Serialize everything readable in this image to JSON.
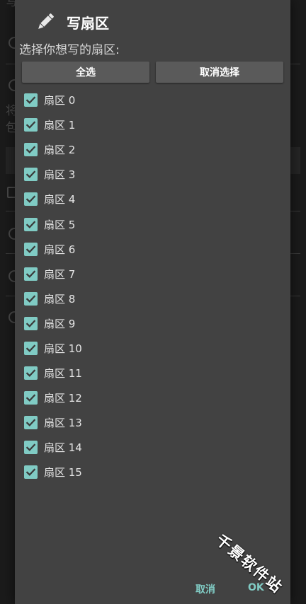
{
  "dialog": {
    "title": "写扇区",
    "icon": "pencil-icon",
    "subtitle": "选择你想写的扇区:",
    "select_all_label": "全选",
    "deselect_label": "取消选择",
    "sectors": [
      {
        "label": "扇区 0",
        "checked": true
      },
      {
        "label": "扇区 1",
        "checked": true
      },
      {
        "label": "扇区 2",
        "checked": true
      },
      {
        "label": "扇区 3",
        "checked": true
      },
      {
        "label": "扇区 4",
        "checked": true
      },
      {
        "label": "扇区 5",
        "checked": true
      },
      {
        "label": "扇区 6",
        "checked": true
      },
      {
        "label": "扇区 7",
        "checked": true
      },
      {
        "label": "扇区 8",
        "checked": true
      },
      {
        "label": "扇区 9",
        "checked": true
      },
      {
        "label": "扇区 10",
        "checked": true
      },
      {
        "label": "扇区 11",
        "checked": true
      },
      {
        "label": "扇区 12",
        "checked": true
      },
      {
        "label": "扇区 13",
        "checked": true
      },
      {
        "label": "扇区 14",
        "checked": true
      },
      {
        "label": "扇区 15",
        "checked": true
      }
    ],
    "cancel_label": "取消",
    "ok_label": "OK"
  },
  "background": {
    "text_fragments": [
      "写",
      "将",
      "包"
    ]
  },
  "watermark": "千景软件站",
  "colors": {
    "accent": "#80cbc4",
    "dialog_bg": "#424242",
    "button_bg": "#5a5a5a"
  }
}
